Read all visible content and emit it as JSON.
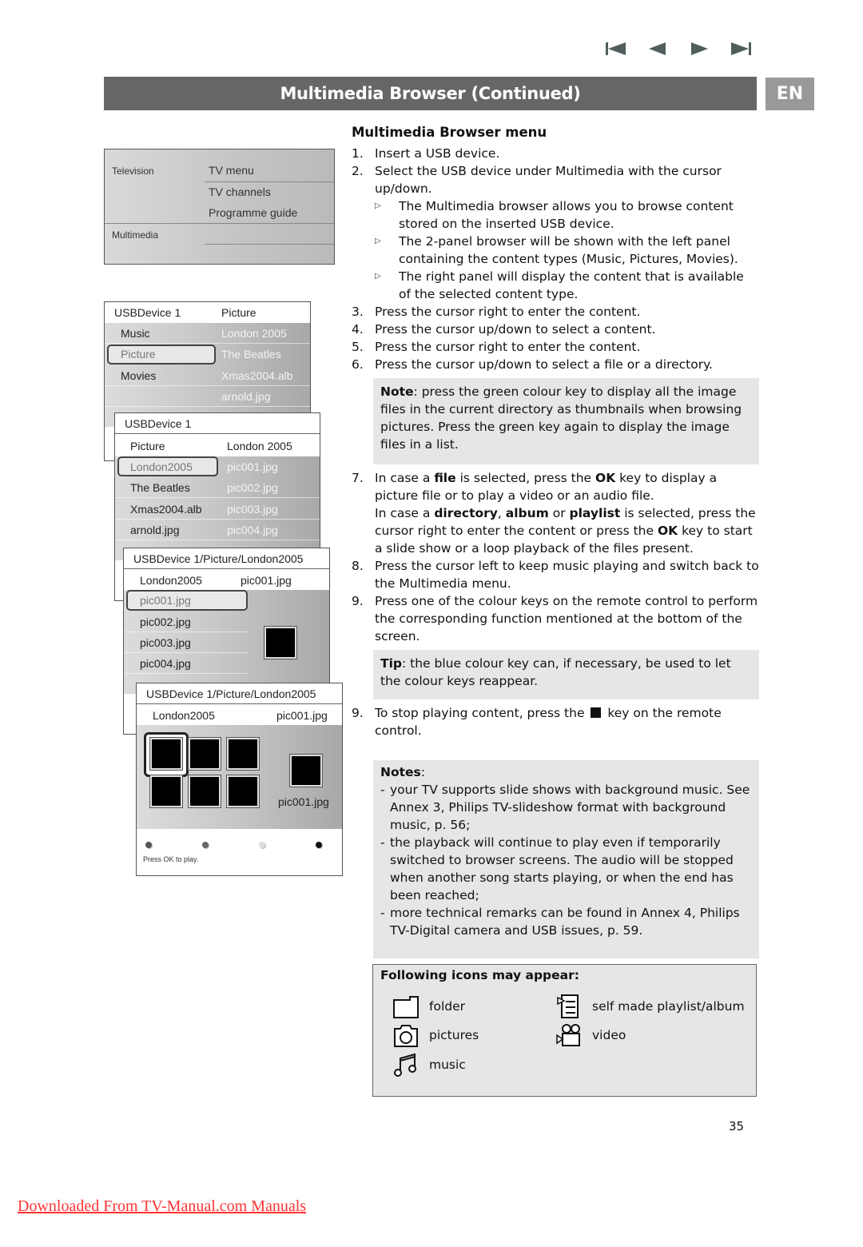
{
  "nav": {
    "icons": [
      "skip-to-start-icon",
      "previous-icon",
      "next-icon",
      "skip-to-end-icon"
    ]
  },
  "header": {
    "title": "Multimedia Browser  (Continued)",
    "language": "EN"
  },
  "tv_menu": {
    "categories": [
      "Television",
      "Multimedia"
    ],
    "items": [
      "TV menu",
      "TV channels",
      "Programme guide"
    ]
  },
  "browser_screens": {
    "screen1": {
      "header_left": "USBDevice 1",
      "header_right": "Picture",
      "left_items": [
        "Music",
        "Picture",
        "Movies"
      ],
      "right_items": [
        "London 2005",
        "The Beatles",
        "Xmas2004.alb",
        "arnold.jpg"
      ]
    },
    "screen2": {
      "header": "USBDevice 1",
      "sub_left": "Picture",
      "sub_right": "London 2005",
      "left_items": [
        "London2005",
        "The Beatles",
        "Xmas2004.alb",
        "arnold.jpg"
      ],
      "right_items": [
        "pic001.jpg",
        "pic002.jpg",
        "pic003.jpg",
        "pic004.jpg"
      ]
    },
    "screen3": {
      "header": "USBDevice 1/Picture/London2005",
      "sub_left": "London2005",
      "sub_right": "pic001.jpg",
      "left_items": [
        "pic001.jpg",
        "pic002.jpg",
        "pic003.jpg",
        "pic004.jpg"
      ]
    },
    "screen4": {
      "header": "USBDevice 1/Picture/London2005",
      "sub_left": "London2005",
      "sub_right": "pic001.jpg",
      "preview_caption": "pic001.jpg",
      "status": "Press OK to play.",
      "colour_keys": [
        "#555555",
        "#666666",
        "#dddddd",
        "#111111"
      ]
    }
  },
  "content": {
    "heading": "Multimedia Browser menu",
    "steps": {
      "s1": {
        "num": "1.",
        "text": "Insert a USB device."
      },
      "s2": {
        "num": "2.",
        "text": "Select the USB device under Multimedia with the cursor up/down."
      },
      "s2_subs": [
        "The Multimedia browser allows you to browse content stored on the inserted USB device.",
        "The 2-panel browser will be shown with the left panel containing the content types (Music, Pictures, Movies).",
        "The right panel will display the content that is available of the selected content type."
      ],
      "s3": {
        "num": "3.",
        "text": "Press the cursor right to enter the content."
      },
      "s4": {
        "num": "4.",
        "text": "Press the cursor up/down to select a content."
      },
      "s5": {
        "num": "5.",
        "text": "Press the cursor right to enter the content."
      },
      "s6": {
        "num": "6.",
        "text": "Press the cursor up/down to select a file or a directory."
      },
      "note_label": "Note",
      "note_text": ": press the green colour key to display all the image files in the current directory as thumbnails when browsing pictures. Press the green key again to display the image files in a list.",
      "s7": {
        "num": "7.",
        "p1_a": "In case a ",
        "p1_b1": "file",
        "p1_c": " is selected, press the ",
        "p1_b2": "OK",
        "p1_d": " key to display a picture file or to play a video or an audio file.",
        "p2_a": "In case a ",
        "p2_b1": "directory",
        "p2_c": ", ",
        "p2_b2": "album",
        "p2_d": " or ",
        "p2_b3": "playlist",
        "p2_e": " is selected, press the cursor right to enter the content or press the ",
        "p2_b4": "OK",
        "p2_f": " key to start a slide show or a loop playback of the files present."
      },
      "s8": {
        "num": "8.",
        "text": "Press the cursor left to keep music playing and switch back to the Multimedia menu."
      },
      "s9": {
        "num": "9.",
        "text": "Press one of the colour keys on the remote control to perform the corresponding function mentioned at the bottom of the screen."
      },
      "tip_label": "Tip",
      "tip_text": ": the blue colour key can, if necessary, be used to let the colour keys reappear.",
      "s9b": {
        "num": "9.",
        "text_a": "To stop playing content, press the ",
        "text_b": " key on the remote control."
      },
      "notes_label": "Notes",
      "notes": [
        "your TV supports slide shows with background music. See Annex 3, Philips TV-slideshow format with background music, p. 56;",
        "the playback will continue to play even if temporarily switched to browser screens. The audio will be stopped when another song starts playing, or when the end has been reached;",
        "more technical remarks can be found in Annex 4, Philips TV-Digital camera and USB issues, p. 59."
      ]
    }
  },
  "icons_box": {
    "title": "Following icons may appear:",
    "items": [
      {
        "icon": "folder-icon",
        "label": "folder"
      },
      {
        "icon": "pictures-icon",
        "label": "pictures"
      },
      {
        "icon": "music-icon",
        "label": "music"
      },
      {
        "icon": "playlist-icon",
        "label": "self made playlist/album"
      },
      {
        "icon": "video-icon",
        "label": "video"
      }
    ]
  },
  "page_number": "35",
  "footer_link": "Downloaded From TV-Manual.com Manuals"
}
